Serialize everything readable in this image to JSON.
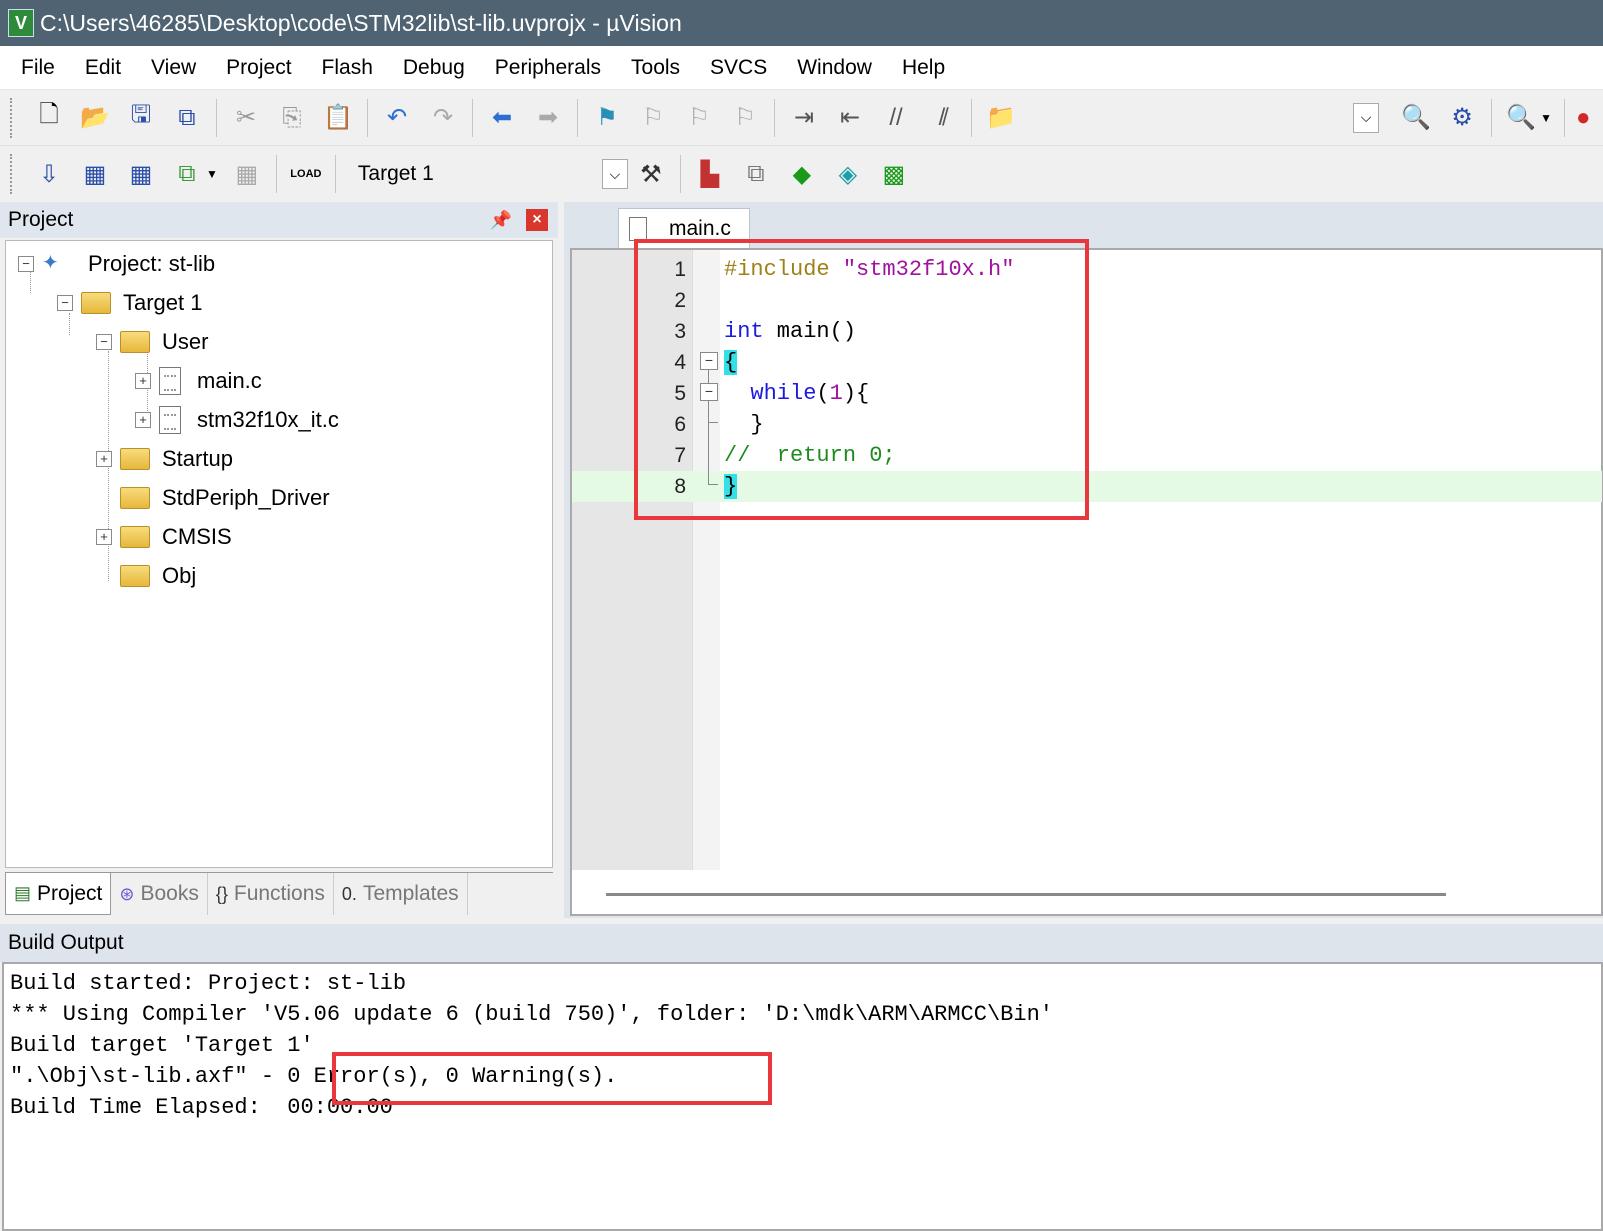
{
  "window": {
    "title": "C:\\Users\\46285\\Desktop\\code\\STM32lib\\st-lib.uvprojx - µVision",
    "app_icon_label": "V"
  },
  "menu": [
    "File",
    "Edit",
    "View",
    "Project",
    "Flash",
    "Debug",
    "Peripherals",
    "Tools",
    "SVCS",
    "Window",
    "Help"
  ],
  "toolbar2": {
    "target": "Target 1",
    "load_label": "LOAD"
  },
  "project_panel": {
    "title": "Project",
    "tree": {
      "project": "Project: st-lib",
      "target": "Target 1",
      "user_group": "User",
      "file_main": "main.c",
      "file_it": "stm32f10x_it.c",
      "startup": "Startup",
      "stdperiph": "StdPeriph_Driver",
      "cmsis": "CMSIS",
      "obj": "Obj"
    },
    "tabs": {
      "project": "Project",
      "books": "Books",
      "functions": "Functions",
      "templates": "Templates"
    }
  },
  "editor": {
    "tab": "main.c",
    "line_numbers": [
      "1",
      "2",
      "3",
      "4",
      "5",
      "6",
      "7",
      "8"
    ],
    "lines": {
      "l1_pre": "#include",
      "l1_str": "\"stm32f10x.h\"",
      "l3_kw": "int",
      "l3_rest": " main()",
      "l4_brace": "{",
      "l5_kw": "while",
      "l5_open": "(",
      "l5_num": "1",
      "l5_close": "){",
      "l6": "}",
      "l7_cmt": "//  return 0;",
      "l8_brace": "}"
    }
  },
  "build_output": {
    "title": "Build Output",
    "lines": [
      "Build started: Project: st-lib",
      "*** Using Compiler 'V5.06 update 6 (build 750)', folder: 'D:\\mdk\\ARM\\ARMCC\\Bin'",
      "Build target 'Target 1'",
      "\".\\Obj\\st-lib.axf\" - 0 Error(s), 0 Warning(s).",
      "Build Time Elapsed:  00:00:00"
    ]
  },
  "colors": {
    "titlebar": "#4f6373",
    "annotation_red": "#e8383d",
    "current_line": "#e4fae4",
    "brace_highlight": "#32e0e6"
  }
}
